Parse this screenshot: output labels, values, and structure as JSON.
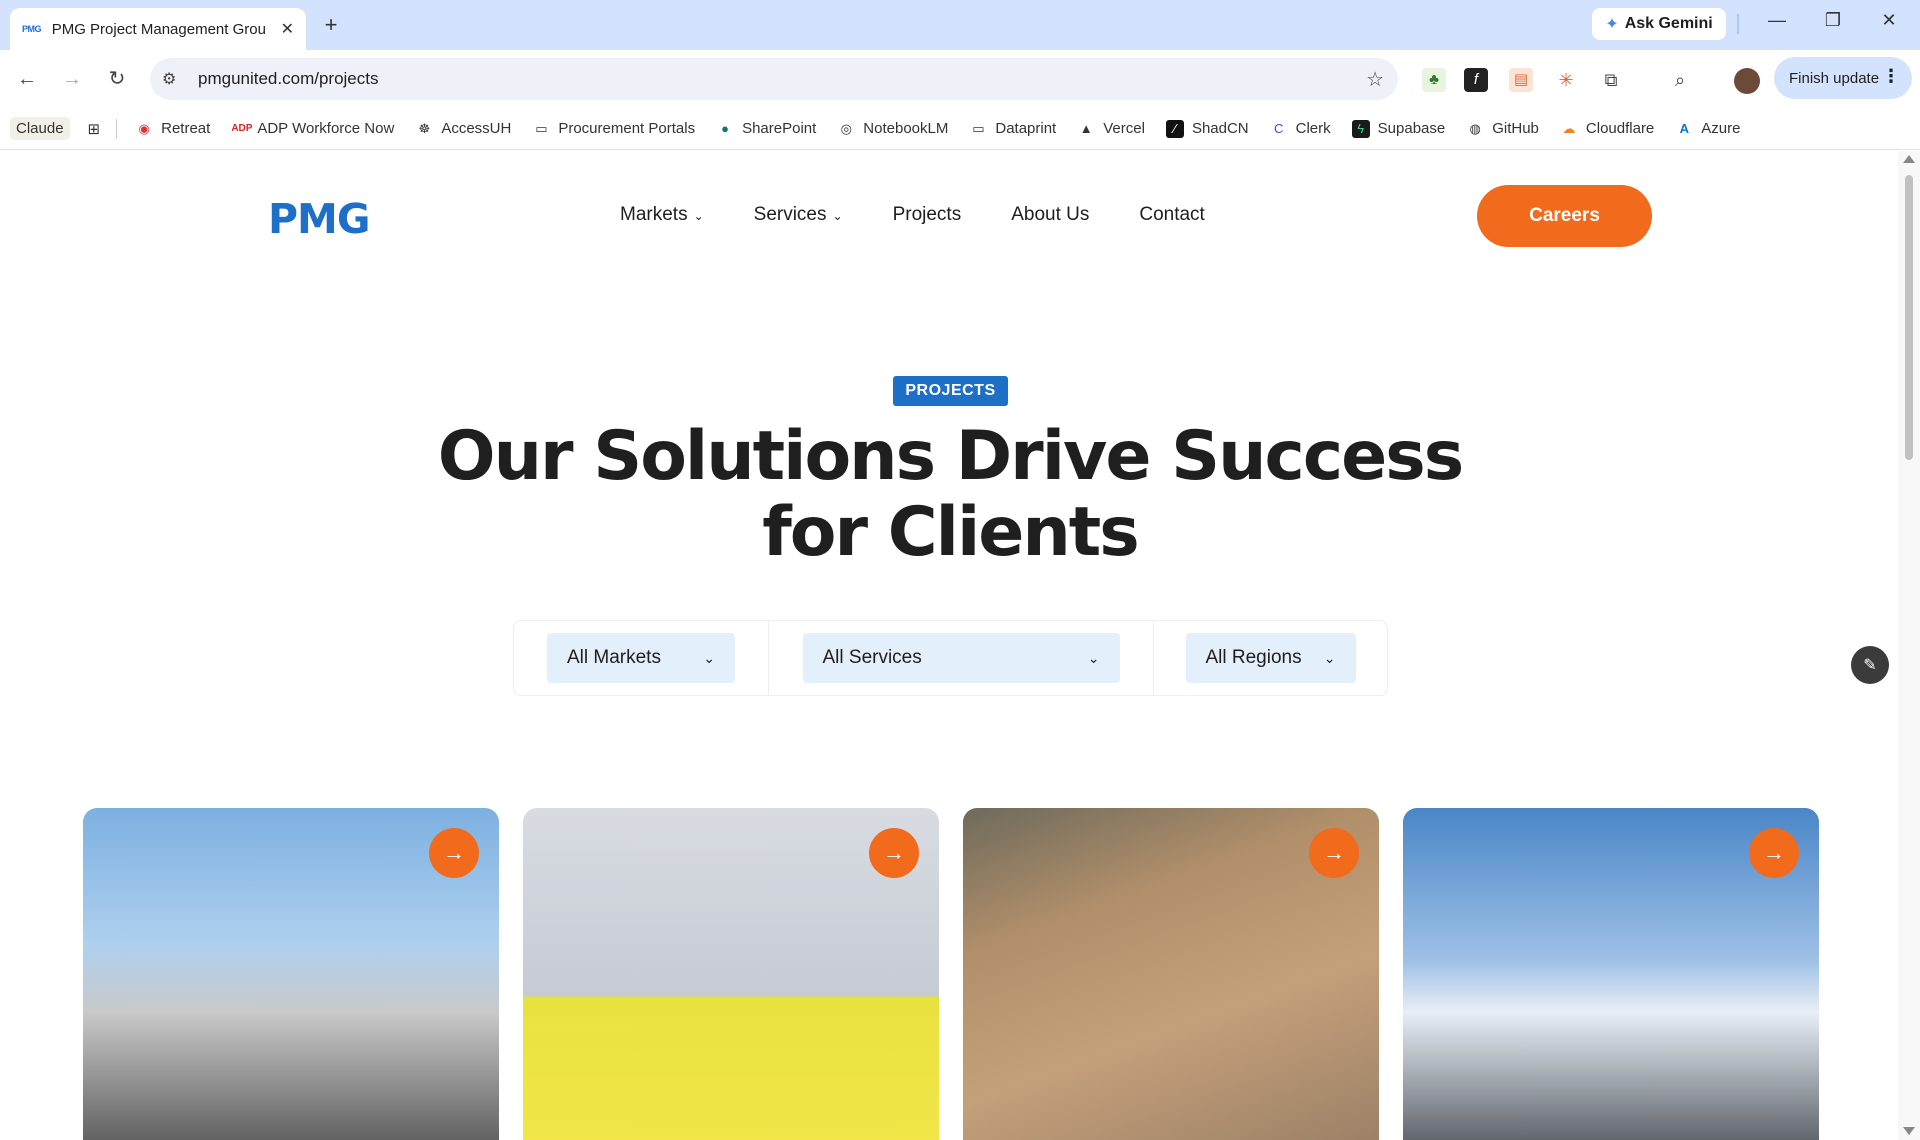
{
  "browser": {
    "tab_title": "PMG Project Management Grou",
    "tab_favicon": "PMG",
    "ask_gemini": "Ask Gemini",
    "url": "pmgunited.com/projects",
    "finish_update": "Finish update"
  },
  "bookmarks": {
    "claude": "Claude",
    "items": [
      "Retreat",
      "ADP Workforce Now",
      "AccessUH",
      "Procurement Portals",
      "SharePoint",
      "NotebookLM",
      "Dataprint",
      "Vercel",
      "ShadCN",
      "Clerk",
      "Supabase",
      "GitHub",
      "Cloudflare",
      "Azure"
    ]
  },
  "site": {
    "logo": "PMG",
    "nav": {
      "markets": "Markets",
      "services": "Services",
      "projects": "Projects",
      "about": "About Us",
      "contact": "Contact"
    },
    "careers": "Careers",
    "badge": "PROJECTS",
    "headline_line1": "Our Solutions Drive Success",
    "headline_line2": "for Clients",
    "filters": {
      "markets": "All Markets",
      "services": "All Services",
      "regions": "All Regions"
    }
  },
  "colors": {
    "brand_blue": "#1e6fc8",
    "accent_orange": "#f26a1b",
    "filter_bg": "#e3effa"
  },
  "icons": {
    "card_arrow": "arrow-right-icon",
    "edit": "pencil-icon"
  }
}
